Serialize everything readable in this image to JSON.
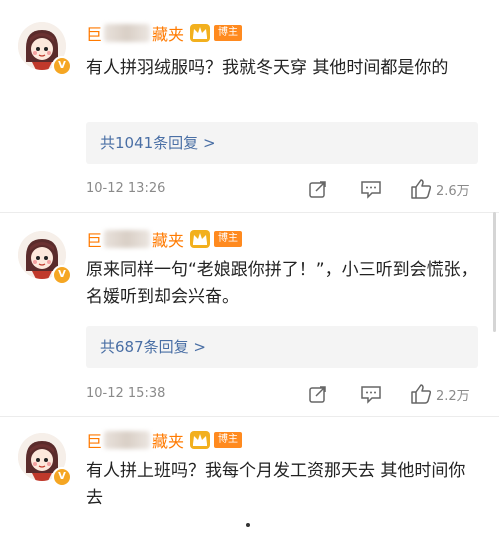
{
  "comments": [
    {
      "name_prefix": "巨",
      "name_suffix": "藏夹",
      "badge": "博主",
      "text": "有人拼羽绒服吗？我就冬天穿 其他时间都是你的",
      "replies_label": "共1041条回复 >",
      "time": "10-12 13:26",
      "likes": "2.6万"
    },
    {
      "name_prefix": "巨",
      "name_suffix": "藏夹",
      "badge": "博主",
      "text": "原来同样一句“老娘跟你拼了！”，小三听到会慌张，名媛听到却会兴奋。",
      "replies_label": "共687条回复 >",
      "time": "10-12 15:38",
      "likes": "2.2万"
    },
    {
      "name_prefix": "巨",
      "name_suffix": "藏夹",
      "badge": "博主",
      "text": "有人拼上班吗？我每个月发工资那天去 其他时间你去"
    }
  ],
  "colors": {
    "name": "#ff7a00",
    "link": "#4a6fa5",
    "meta": "#8a8a8a",
    "badge": "#ff8a1f"
  },
  "icons": [
    "avatar-cartoon",
    "verified-v-icon",
    "crown-icon",
    "share-icon",
    "comment-icon",
    "like-icon",
    "chevron-right-icon"
  ]
}
